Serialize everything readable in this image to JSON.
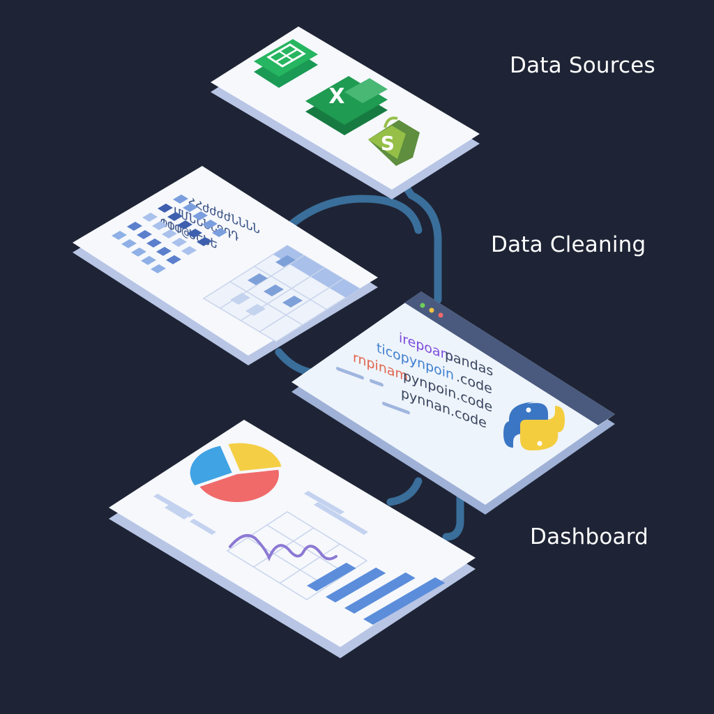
{
  "labels": {
    "sources": "Data Sources",
    "cleaning": "Data Cleaning",
    "dashboard": "Dashboard"
  },
  "sources_panel": {
    "icons": [
      "google-sheets-icon",
      "excel-icon",
      "shopify-icon"
    ],
    "excel_glyph": "X",
    "shopify_glyph": "S"
  },
  "cleaning_panel": {
    "scribble_lines": [
      "ՀՀժժժժՆՆՆՆ",
      "ՄՄՆՆՆՆԴԴԴ",
      "ՓՓՓ@ԵԵԵԵ"
    ]
  },
  "code_panel": {
    "lines": [
      {
        "keyword": "irepoam",
        "text": "pandas",
        "color": "#7c4ddb"
      },
      {
        "keyword": "ticopynpoin",
        "text": ".code",
        "color": "#3f7fd0"
      },
      {
        "keyword": "rnpinam",
        "text": "pynpoin.code",
        "color": "#e0664f"
      },
      {
        "keyword": "",
        "text": "pynnan.code",
        "color": "#3a4660"
      }
    ],
    "logo": "python-logo-icon"
  },
  "dashboard_panel": {
    "pie": [
      {
        "value": 0.45,
        "color": "#f06a6a"
      },
      {
        "value": 0.28,
        "color": "#3fa3e4"
      },
      {
        "value": 0.27,
        "color": "#f4cf45"
      }
    ],
    "bars": [
      0.55,
      0.7,
      0.85,
      1.0
    ],
    "bar_color": "#5b8ddb",
    "line_color": "#8c79d3"
  },
  "colors": {
    "background": "#1e2435",
    "panel": "#f6f8fc",
    "panel_edge": "#b8c5e5",
    "connector": "#3a6e9b"
  }
}
